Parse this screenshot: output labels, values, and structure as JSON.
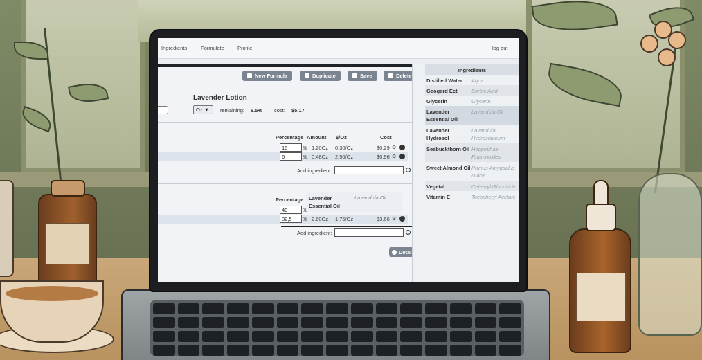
{
  "nav": {
    "items": [
      "Ingredients",
      "Formulate",
      "Profile"
    ],
    "logout": "log out"
  },
  "toolbar": {
    "new_formula": "New Formula",
    "duplicate": "Duplicate",
    "save": "Save",
    "delete": "Delete"
  },
  "formula": {
    "name": "Lavender Lotion",
    "unit": "Oz ▼",
    "remaining_label": "remaining:",
    "remaining_value": "6.5%",
    "cost_label": "cost:",
    "cost_value": "$5.17"
  },
  "columns": {
    "percentage": "Percentage",
    "amount": "Amount",
    "per_oz": "$/Oz",
    "cost": "Cost"
  },
  "phase1": {
    "rows": [
      {
        "pct": "15",
        "pct_unit": "%",
        "amount": "1.20Oz",
        "per_oz": "0.30/Oz",
        "cost": "$0.29"
      },
      {
        "pct": "6",
        "pct_unit": "%",
        "amount": "0.48Oz",
        "per_oz": "2.50/Oz",
        "cost": "$0.96"
      }
    ],
    "add_label": "Add ingredient:"
  },
  "phase2": {
    "rows": [
      {
        "pct": "40",
        "pct_unit": "%",
        "amount": "",
        "per_oz": "",
        "cost": ""
      },
      {
        "pct": "32,5",
        "pct_unit": "%",
        "amount": "2.60Oz",
        "per_oz": "1.75/Oz",
        "cost": "$3.66"
      }
    ],
    "add_label": "Add ingredient:"
  },
  "details_button": "Detail",
  "drag_ghost": {
    "name": "Lavender Essential Oil",
    "latin": "Lavandula Oil"
  },
  "ingredients_panel": {
    "title": "Ingredients",
    "items": [
      {
        "name": "Distilled Water",
        "latin": "Aqua"
      },
      {
        "name": "Geogard Ect",
        "latin": "Sorbic Acid"
      },
      {
        "name": "Glycerin",
        "latin": "Glycerin"
      },
      {
        "name": "Lavender Essential Oil",
        "latin": "Lavandula Oil"
      },
      {
        "name": "Lavender Hydrosol",
        "latin": "Lavandula Hydrosolanum"
      },
      {
        "name": "Seabuckthorn Oil",
        "latin": "Hoppophae Rhamnoides"
      },
      {
        "name": "Sweet Almond Oil",
        "latin": "Prunus Amygdalus Dulcis"
      },
      {
        "name": "Vegetal",
        "latin": "Cetearyl Glucoside"
      },
      {
        "name": "Vitamin E",
        "latin": "Tocopheryl Acetate"
      }
    ]
  },
  "colors": {
    "button": "#7b8591",
    "panel": "#eef1f4",
    "background_wall": "#6e7858",
    "table_wood": "#c9a779"
  }
}
